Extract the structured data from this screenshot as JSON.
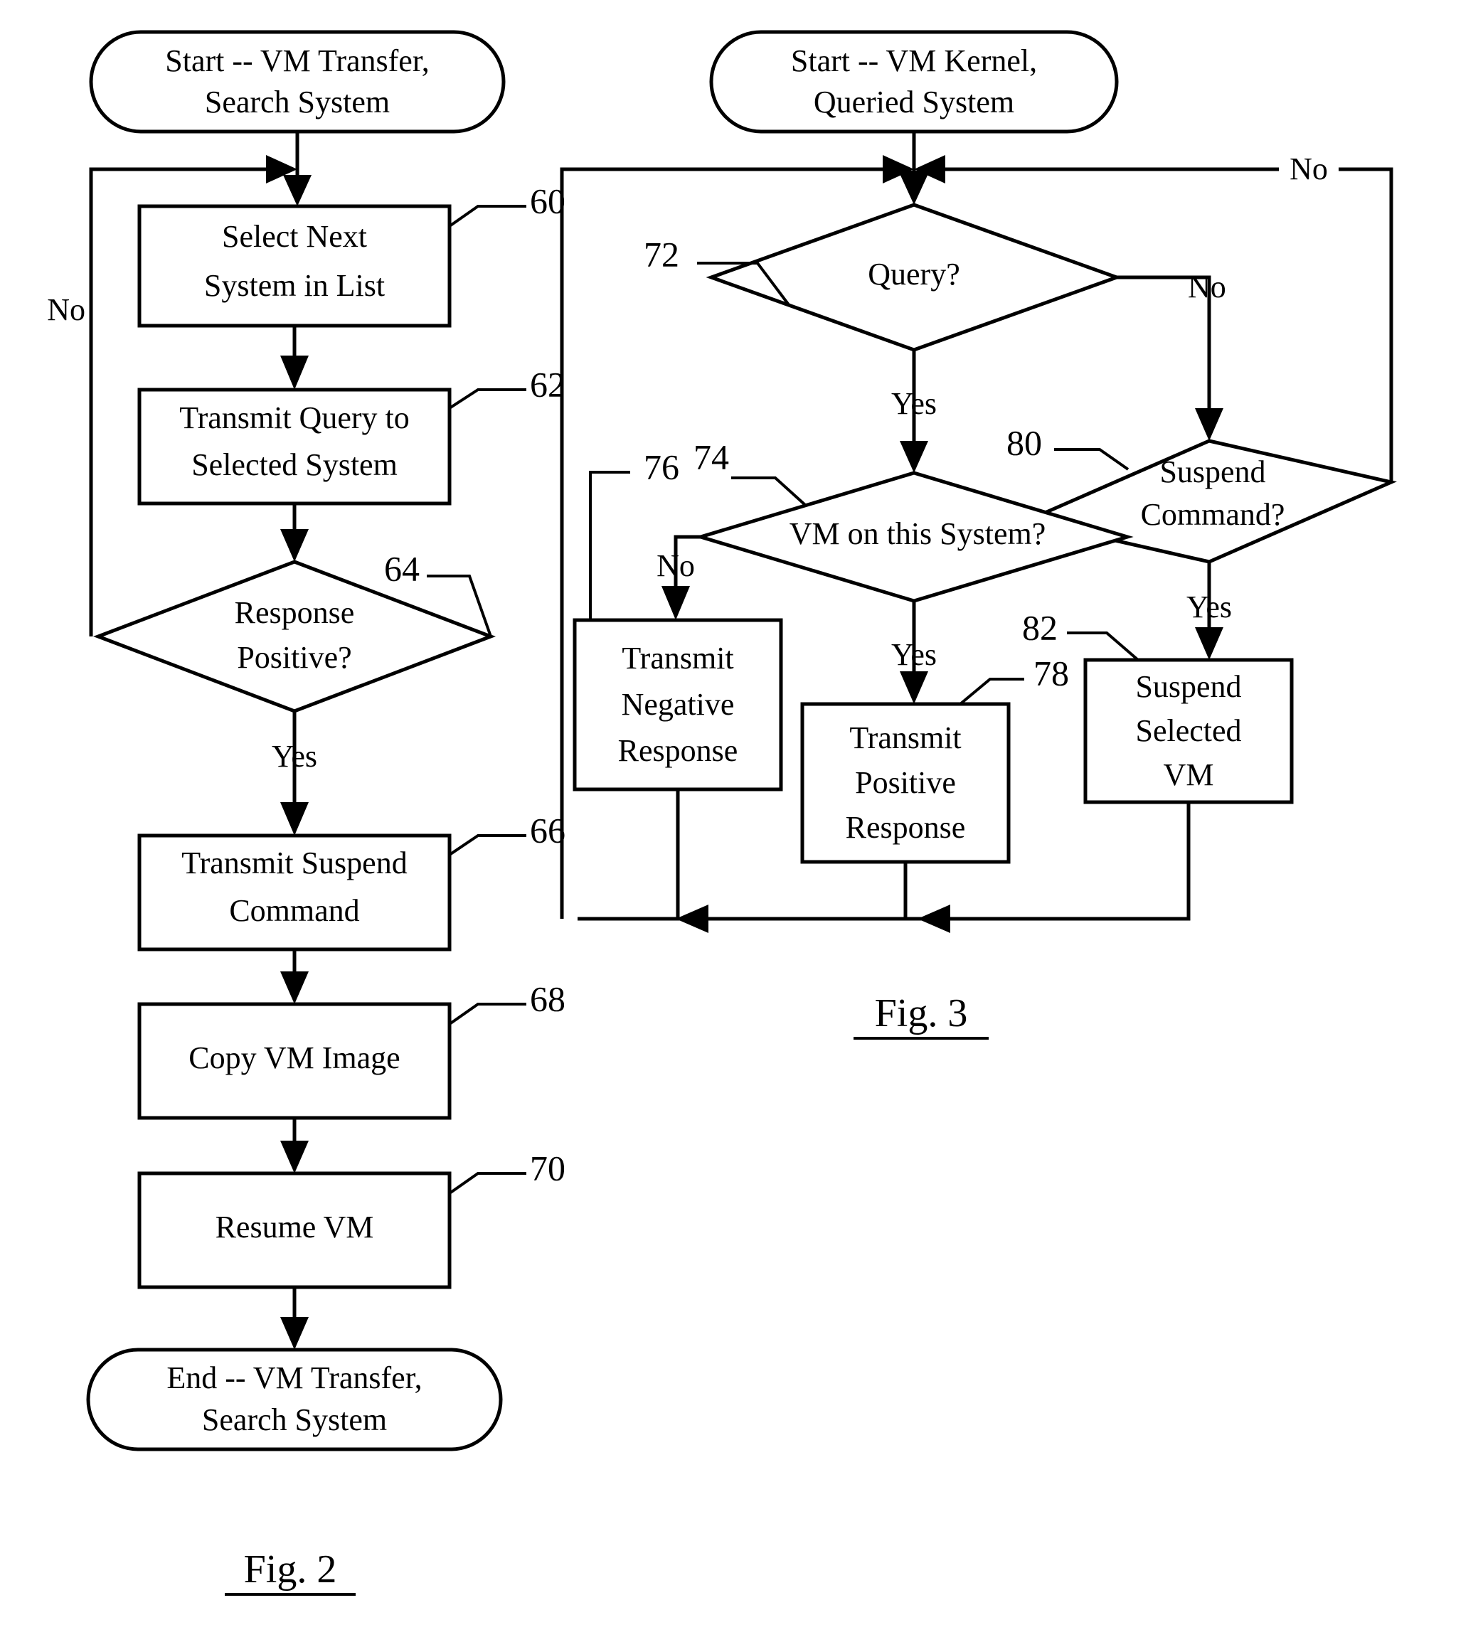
{
  "document": {
    "kind": "patent-flowchart-sheet",
    "figures": [
      {
        "id": "fig2",
        "caption": "Fig. 2",
        "title_text": "Start -- VM Transfer, Search System",
        "nodes": [
          {
            "key": "start",
            "shape": "terminator",
            "line1": "Start -- VM Transfer,",
            "line2": "Search System",
            "ref": ""
          },
          {
            "key": "n60",
            "shape": "process",
            "line1": "Select Next",
            "line2": "System in List",
            "ref": "60"
          },
          {
            "key": "n62",
            "shape": "process",
            "line1": "Transmit Query to",
            "line2": "Selected System",
            "ref": "62"
          },
          {
            "key": "n64",
            "shape": "decision",
            "line1": "Response",
            "line2": "Positive?",
            "ref": "64"
          },
          {
            "key": "n66",
            "shape": "process",
            "line1": "Transmit Suspend",
            "line2": "Command",
            "ref": "66"
          },
          {
            "key": "n68",
            "shape": "process",
            "line1": "Copy VM Image",
            "line2": "",
            "ref": "68"
          },
          {
            "key": "n70",
            "shape": "process",
            "line1": "Resume VM",
            "line2": "",
            "ref": "70"
          },
          {
            "key": "end",
            "shape": "terminator",
            "line1": "End -- VM Transfer,",
            "line2": "Search System",
            "ref": ""
          }
        ],
        "edge_labels": [
          {
            "key": "no_loop",
            "text": "No"
          },
          {
            "key": "yes_down",
            "text": "Yes"
          }
        ]
      },
      {
        "id": "fig3",
        "caption": "Fig. 3",
        "title_text": "Start -- VM Kernel, Queried System",
        "nodes": [
          {
            "key": "start",
            "shape": "terminator",
            "line1": "Start -- VM Kernel,",
            "line2": "Queried System",
            "ref": ""
          },
          {
            "key": "n72",
            "shape": "decision",
            "line1": "Query?",
            "line2": "",
            "ref": "72"
          },
          {
            "key": "n74",
            "shape": "decision",
            "line1": "VM on this System?",
            "line2": "",
            "ref": "74"
          },
          {
            "key": "n80",
            "shape": "decision",
            "line1": "Suspend",
            "line2": "Command?",
            "ref": "80"
          },
          {
            "key": "n76",
            "shape": "process",
            "line1": "Transmit",
            "line2": "Negative",
            "line3": "Response",
            "ref": "76"
          },
          {
            "key": "n78",
            "shape": "process",
            "line1": "Transmit",
            "line2": "Positive",
            "line3": "Response",
            "ref": "78"
          },
          {
            "key": "n82",
            "shape": "process",
            "line1": "Suspend",
            "line2": "Selected",
            "line3": "VM",
            "ref": "82"
          }
        ],
        "edge_labels": [
          {
            "key": "no_top_right",
            "text": "No"
          },
          {
            "key": "no_query_right",
            "text": "No"
          },
          {
            "key": "yes_query_down",
            "text": "Yes"
          },
          {
            "key": "no_vm_left",
            "text": "No"
          },
          {
            "key": "yes_vm_down",
            "text": "Yes"
          },
          {
            "key": "yes_suspend",
            "text": "Yes"
          }
        ]
      }
    ]
  },
  "fig2": {
    "caption": "Fig. 2",
    "start": {
      "line1": "Start -- VM Transfer,",
      "line2": "Search System"
    },
    "n60": {
      "line1": "Select Next",
      "line2": "System in List",
      "ref": "60"
    },
    "n62": {
      "line1": "Transmit Query to",
      "line2": "Selected System",
      "ref": "62"
    },
    "n64": {
      "line1": "Response",
      "line2": "Positive?",
      "ref": "64"
    },
    "n66": {
      "line1": "Transmit Suspend",
      "line2": "Command",
      "ref": "66"
    },
    "n68": {
      "line1": "Copy VM Image",
      "ref": "68"
    },
    "n70": {
      "line1": "Resume VM",
      "ref": "70"
    },
    "end": {
      "line1": "End -- VM Transfer,",
      "line2": "Search System"
    },
    "labels": {
      "no": "No",
      "yes": "Yes"
    }
  },
  "fig3": {
    "caption": "Fig. 3",
    "start": {
      "line1": "Start -- VM Kernel,",
      "line2": "Queried System"
    },
    "n72": {
      "line1": "Query?",
      "ref": "72"
    },
    "n74": {
      "line1": "VM on this System?",
      "ref": "74"
    },
    "n80": {
      "line1": "Suspend",
      "line2": "Command?",
      "ref": "80"
    },
    "n76": {
      "line1": "Transmit",
      "line2": "Negative",
      "line3": "Response",
      "ref": "76"
    },
    "n78": {
      "line1": "Transmit",
      "line2": "Positive",
      "line3": "Response",
      "ref": "78"
    },
    "n82": {
      "line1": "Suspend",
      "line2": "Selected",
      "line3": "VM",
      "ref": "82"
    },
    "labels": {
      "no_top": "No",
      "no_query": "No",
      "yes_query": "Yes",
      "no_vm": "No",
      "yes_vm": "Yes",
      "yes_suspend": "Yes"
    }
  },
  "colors": {
    "ink": "#000000",
    "paper": "#ffffff"
  }
}
